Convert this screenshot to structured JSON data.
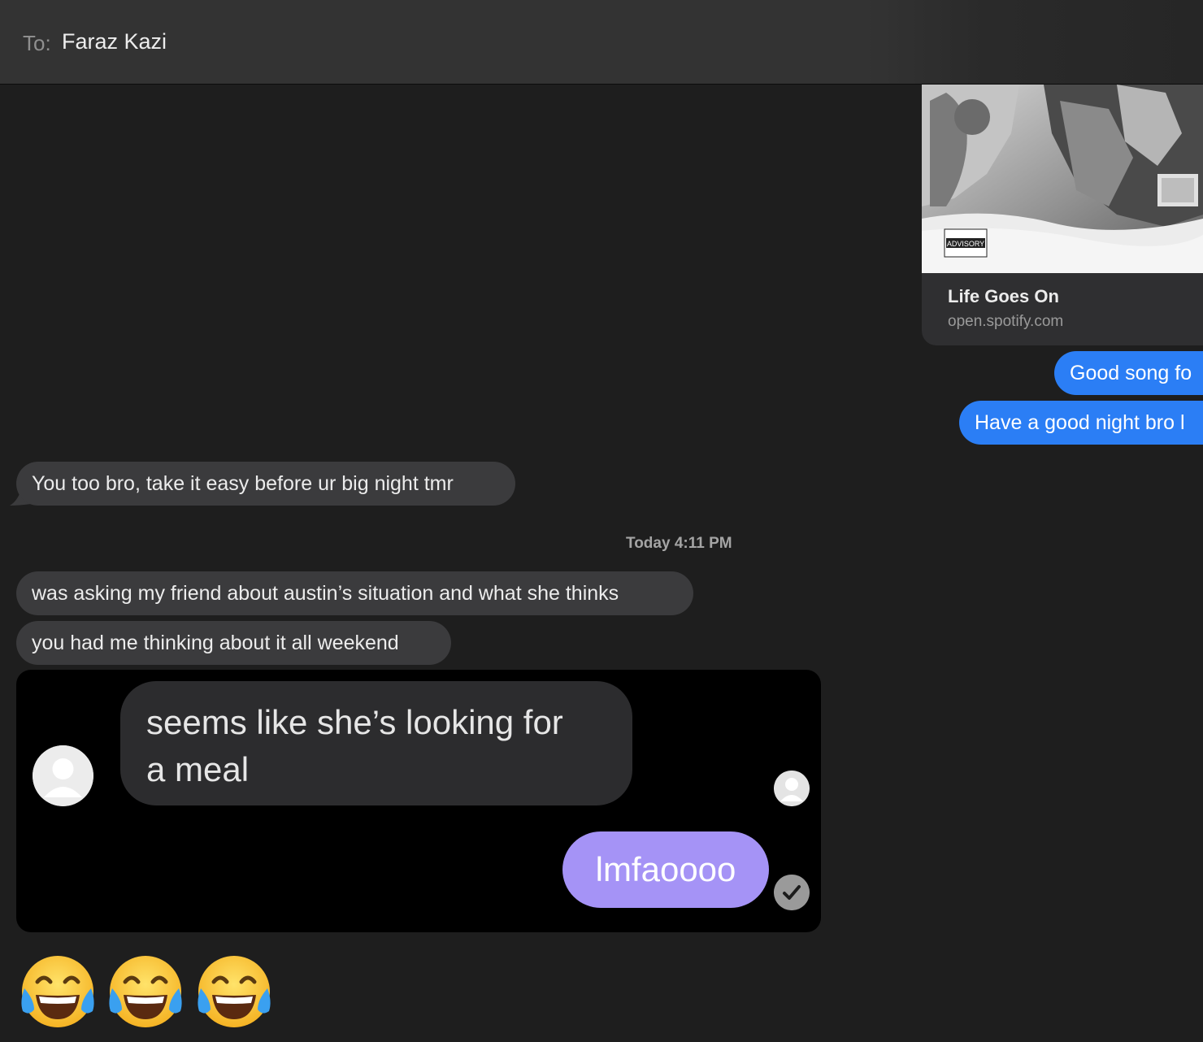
{
  "header": {
    "to_label": "To:",
    "recipient": "Faraz Kazi"
  },
  "link_preview": {
    "title": "Life Goes On",
    "domain": "open.spotify.com",
    "album_text": "ADVISORY"
  },
  "messages": {
    "out_1": "Good song fo",
    "out_2": "Have a good night bro l",
    "in_1": "You too bro, take it easy before ur big night tmr",
    "timestamp": "Today 4:11 PM",
    "in_2": "was asking my friend about austin’s situation and what she thinks",
    "in_3": "you had me thinking about it all weekend"
  },
  "attached_screenshot": {
    "incoming_text_line1": "seems like she’s looking for",
    "incoming_text_line2": "a meal",
    "outgoing_text": "lmfaoooo"
  },
  "emoji_reply": {
    "emoji_name": "face-with-tears-of-joy",
    "count": 3
  },
  "colors": {
    "background": "#1e1e1e",
    "incoming_bubble": "#3b3b3d",
    "outgoing_bubble": "#2b7ef5",
    "screenshot_outgoing": "#a593f6"
  }
}
